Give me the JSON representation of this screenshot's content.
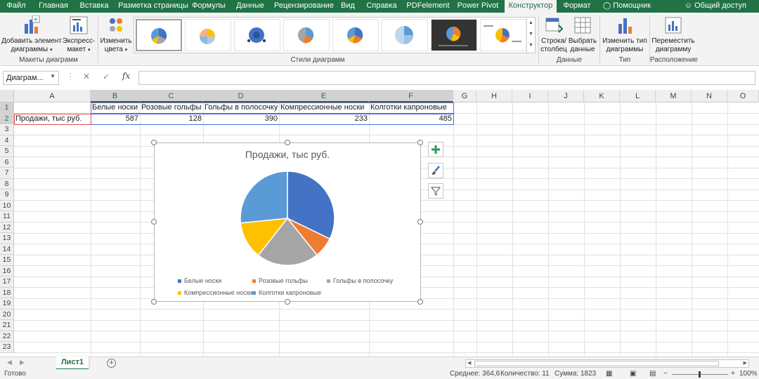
{
  "ribbon_tabs": [
    {
      "label": "Файл"
    },
    {
      "label": "Главная"
    },
    {
      "label": "Вставка"
    },
    {
      "label": "Разметка страницы"
    },
    {
      "label": "Формулы"
    },
    {
      "label": "Данные"
    },
    {
      "label": "Рецензирование"
    },
    {
      "label": "Вид"
    },
    {
      "label": "Справка"
    },
    {
      "label": "PDFelement"
    },
    {
      "label": "Power Pivot"
    },
    {
      "label": "Конструктор"
    },
    {
      "label": "Формат"
    }
  ],
  "help_label": "Помощник",
  "share_label": "Общий доступ",
  "ribbon": {
    "add_element": {
      "line1": "Добавить элемент",
      "line2": "диаграммы"
    },
    "quick_layout": {
      "line1": "Экспресс-",
      "line2": "макет"
    },
    "layouts_group": "Макеты диаграмм",
    "change_colors": {
      "line1": "Изменить",
      "line2": "цвета"
    },
    "styles_group": "Стили диаграмм",
    "switch_row_col": {
      "line1": "Строка/",
      "line2": "столбец"
    },
    "select_data": {
      "line1": "Выбрать",
      "line2": "данные"
    },
    "data_group": "Данные",
    "change_type": {
      "line1": "Изменить тип",
      "line2": "диаграммы"
    },
    "type_group": "Тип",
    "move_chart": {
      "line1": "Переместить",
      "line2": "диаграмму"
    },
    "location_group": "Расположение"
  },
  "formula_bar": {
    "name_box": "Диаграм...",
    "formula": ""
  },
  "columns": [
    "A",
    "B",
    "C",
    "D",
    "E",
    "F",
    "G",
    "H",
    "I",
    "J",
    "K",
    "L",
    "M",
    "N",
    "O"
  ],
  "rows": [
    "1",
    "2",
    "3",
    "4",
    "5",
    "6",
    "7",
    "8",
    "9",
    "10",
    "11",
    "12",
    "13",
    "14",
    "15",
    "16",
    "17",
    "18",
    "19",
    "20",
    "21",
    "22",
    "23"
  ],
  "sheet": {
    "headers": [
      "Белые носки",
      "Розовые гольфы",
      "Гольфы в полосочку",
      "Компрессионные носки",
      "Колготки капроновые"
    ],
    "row_label": "Продажи, тыс руб.",
    "values": [
      "587",
      "128",
      "390",
      "233",
      "485"
    ]
  },
  "chart_data": {
    "type": "pie",
    "title": "Продажи, тыс руб.",
    "categories": [
      "Белые носки",
      "Розовые гольфы",
      "Гольфы в полосочку",
      "Компрессионные носки",
      "Колготки капроновые"
    ],
    "values": [
      587,
      128,
      390,
      233,
      485
    ],
    "colors": [
      "#4472C4",
      "#ED7D31",
      "#A5A5A5",
      "#FFC000",
      "#5B9BD5"
    ],
    "legend_position": "bottom"
  },
  "sheet_tabs": [
    {
      "label": "Лист1"
    }
  ],
  "status": {
    "ready": "Готово",
    "average": "Среднее: 364,6",
    "count": "Количество: 11",
    "sum": "Сумма: 1823",
    "zoom": "100%"
  },
  "accent_color": "#217346"
}
